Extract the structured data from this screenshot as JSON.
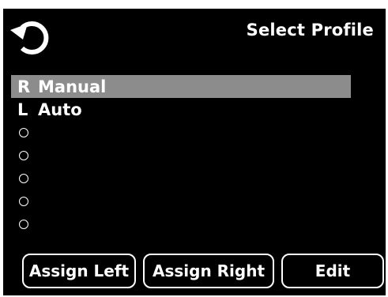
{
  "header": {
    "title": "Select Profile",
    "back_icon": "refresh-icon"
  },
  "profiles": [
    {
      "side": "R",
      "name": "Manual",
      "selected": true
    },
    {
      "side": "L",
      "name": "Auto",
      "selected": false
    },
    {
      "side": "",
      "name": "",
      "empty": true
    },
    {
      "side": "",
      "name": "",
      "empty": true
    },
    {
      "side": "",
      "name": "",
      "empty": true
    },
    {
      "side": "",
      "name": "",
      "empty": true
    },
    {
      "side": "",
      "name": "",
      "empty": true
    }
  ],
  "buttons": {
    "assign_left": "Assign Left",
    "assign_right": "Assign Right",
    "edit": "Edit"
  },
  "colors": {
    "background": "#000000",
    "text": "#ffffff",
    "selection": "#8c8c8c"
  }
}
